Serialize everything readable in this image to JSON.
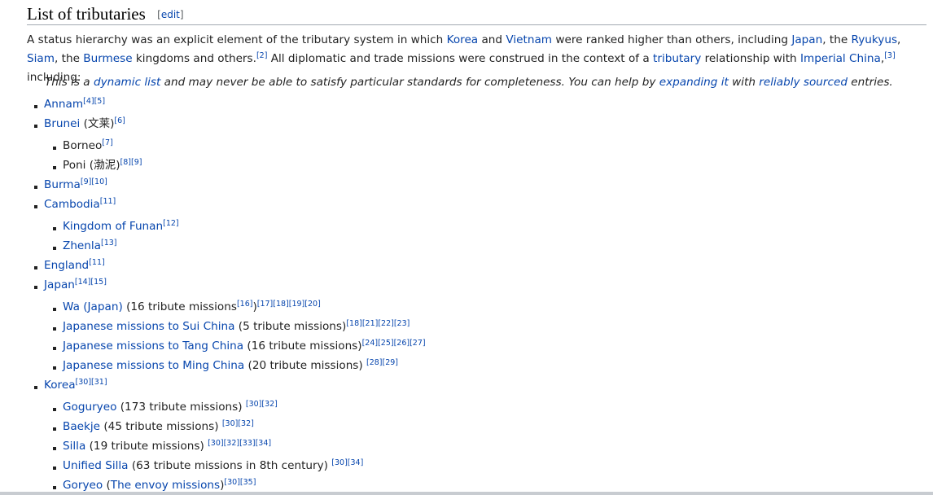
{
  "section": {
    "title": "List of tributaries",
    "edit_label": "edit",
    "bracket_open": "[",
    "bracket_close": "]"
  },
  "intro": {
    "t1": "A status hierarchy was an explicit element of the tributary system in which ",
    "korea": "Korea",
    "t2": " and ",
    "vietnam": "Vietnam",
    "t3": " were ranked higher than others, including ",
    "japan": "Japan",
    "t4": ", the ",
    "ryukyus": "Ryukyus",
    "t5": ", ",
    "siam": "Siam",
    "t6": ", the ",
    "burmese": "Burmese",
    "t7": " kingdoms and others.",
    "ref1": "[2]",
    "t8": " All diplomatic and trade missions were construed in the context of a ",
    "tributary": "tributary",
    "t9": " relationship with ",
    "imperial_china": "Imperial China",
    "t10": ",",
    "ref2": "[3]",
    "t11": " including:"
  },
  "hatnote": {
    "t1": "This is a ",
    "dynamic_list": "dynamic list",
    "t2": " and may never be able to satisfy particular standards for completeness. You can help by ",
    "expanding": "expanding it",
    "t3": " with ",
    "reliably": "reliably sourced",
    "t4": " entries."
  },
  "items": [
    {
      "link": "Annam",
      "text": "",
      "refs": "[4][5]"
    },
    {
      "link": "Brunei",
      "text": " (文莱)",
      "refs": "[6]"
    },
    {
      "link": "",
      "text": "Borneo",
      "refs": "[7]"
    },
    {
      "link": "",
      "text": "Poni (渤泥)",
      "refs": "[8][9]"
    },
    {
      "link": "Burma",
      "text": "",
      "refs": "[9][10]"
    },
    {
      "link": "Cambodia",
      "text": "",
      "refs": "[11]"
    },
    {
      "link": "Kingdom of Funan",
      "text": "",
      "refs": "[12]"
    },
    {
      "link": "Zhenla",
      "text": "",
      "refs": "[13]"
    },
    {
      "link": "England",
      "text": "",
      "refs": "[11]"
    },
    {
      "link": "Japan",
      "text": "",
      "refs": "[14][15]"
    },
    {
      "link": "Wa (Japan)",
      "text": " (16 tribute missions",
      "refs": "[16]",
      "text2": ")",
      "refs2": "[17][18][19][20]"
    },
    {
      "link": "Japanese missions to Sui China",
      "text": " (5 tribute missions)",
      "refs": "[18][21][22][23]"
    },
    {
      "link": "Japanese missions to Tang China",
      "text": " (16 tribute missions)",
      "refs": "[24][25][26][27]"
    },
    {
      "link": "Japanese missions to Ming China",
      "text": " (20 tribute missions) ",
      "refs": "[28][29]"
    },
    {
      "link": "Korea",
      "text": "",
      "refs": "[30][31]"
    },
    {
      "link": "Goguryeo",
      "text": " (173 tribute missions) ",
      "refs": "[30][32]"
    },
    {
      "link": "Baekje",
      "text": " (45 tribute missions) ",
      "refs": "[30][32]"
    },
    {
      "link": "Silla",
      "text": " (19 tribute missions) ",
      "refs": "[30][32][33][34]"
    },
    {
      "link": "Unified Silla",
      "text": " (63 tribute missions in 8th century) ",
      "refs": "[30][34]"
    },
    {
      "link": "Goryeo",
      "text": " (",
      "link2": "The envoy missions",
      "text2": ")",
      "refs2": "[30][35]"
    }
  ]
}
